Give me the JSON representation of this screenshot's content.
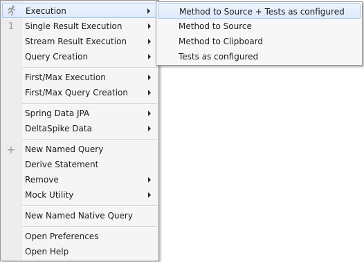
{
  "main_menu": {
    "items": [
      {
        "label": "Execution"
      },
      {
        "label": "Single Result Execution"
      },
      {
        "label": "Stream Result Execution"
      },
      {
        "label": "Query Creation"
      },
      {
        "label": "First/Max Execution"
      },
      {
        "label": "First/Max Query Creation"
      },
      {
        "label": "Spring Data JPA"
      },
      {
        "label": "DeltaSpike Data"
      },
      {
        "label": "New Named Query"
      },
      {
        "label": "Derive Statement"
      },
      {
        "label": "Remove"
      },
      {
        "label": "Mock Utility"
      },
      {
        "label": "New Named Native Query"
      },
      {
        "label": "Open Preferences"
      },
      {
        "label": "Open Help"
      }
    ],
    "badge_single_result": "1",
    "plus_symbol": "+"
  },
  "sub_menu": {
    "items": [
      {
        "label": "Method to Source + Tests as configured"
      },
      {
        "label": "Method to Source"
      },
      {
        "label": "Method to Clipboard"
      },
      {
        "label": "Tests as configured"
      }
    ]
  },
  "colors": {
    "highlight_border": "#a9c6ef",
    "highlight_fill": "#dde9fb",
    "menu_background": "#f5f5f5",
    "icon_gray": "#9a9a9a"
  },
  "icons": {
    "execution": "running-man-icon",
    "single_result": "number-one-icon",
    "new_named_query": "plus-icon",
    "submenu": "chevron-right-icon"
  }
}
